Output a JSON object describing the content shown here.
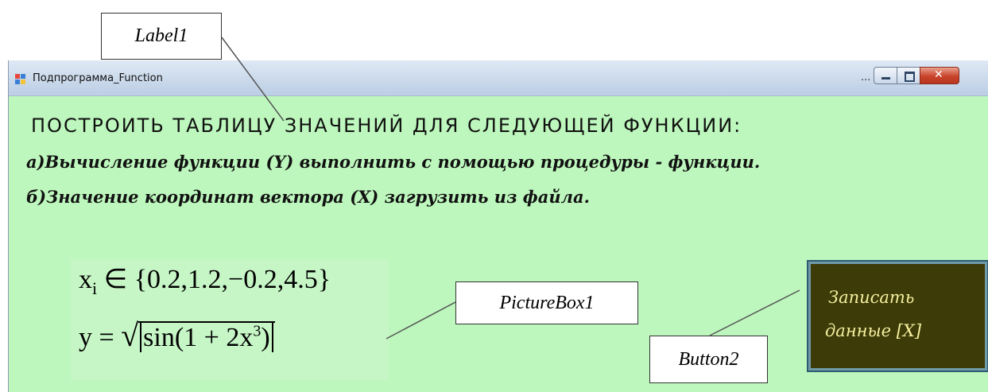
{
  "callouts": {
    "label1": "Label1",
    "picturebox1": "PictureBox1",
    "button2": "Button2"
  },
  "window": {
    "title": "Подпрограмма_Function",
    "overflow_indicator": "..."
  },
  "content": {
    "heading": "ПОСТРОИТЬ ТАБЛИЦУ ЗНАЧЕНИЙ ДЛЯ СЛЕДУЮЩЕЙ ФУНКЦИИ:",
    "line_a": "а)Вычисление функции (Y) выполнить с помощью процедуры - функции.",
    "line_b": "б)Значение координат вектора (X) загрузить из файла."
  },
  "formula": {
    "x_var": "x",
    "x_sub": "i",
    "x_set": "∈ {0.2,1.2,−0.2,4.5}",
    "y_lhs": "y = ",
    "y_expr_pre": "sin(1 + 2x",
    "y_exp": "3",
    "y_expr_post": ")"
  },
  "button": {
    "line1": "Записать",
    "line2": "данные  [X]"
  },
  "colors": {
    "form_bg": "#bdf7bd",
    "button_bg": "#3d3b07",
    "button_text": "#f5f0a0"
  }
}
